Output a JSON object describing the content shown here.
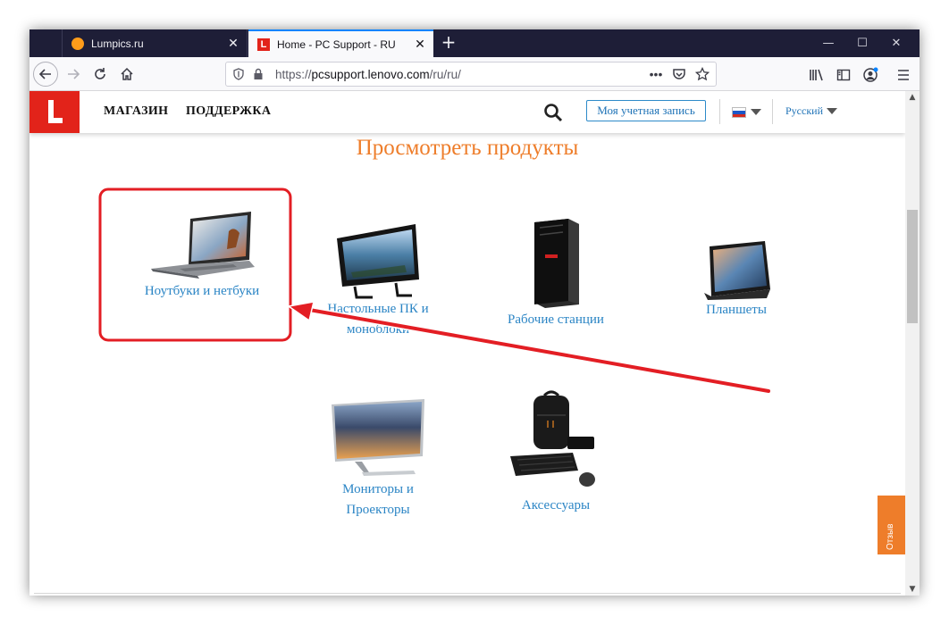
{
  "browser": {
    "tabs": [
      {
        "title": "Lumpics.ru",
        "favicon": "orange-circle-icon",
        "active": false
      },
      {
        "title": "Home - PC Support - RU",
        "favicon": "lenovo-l-icon",
        "active": true
      }
    ],
    "address": {
      "prefix": "https://",
      "host": "pcsupport.lenovo.com",
      "path": "/ru/ru/"
    },
    "accent_color": "#0a84ff"
  },
  "site_header": {
    "logo_letter": "L",
    "nav_shop": "МАГАЗИН",
    "nav_support": "ПОДДЕРЖКА",
    "account_button": "Моя учетная запись",
    "language": "Русский",
    "brand_color": "#e2231a"
  },
  "products": {
    "title": "Просмотреть продукты",
    "items": [
      {
        "label_line1": "Ноутбуки и нетбуки",
        "label_line2": "",
        "icon": "laptop-icon",
        "highlighted": true
      },
      {
        "label_line1": "Настольные ПК и",
        "label_line2": "моноблоки",
        "icon": "all-in-one-desktop-icon"
      },
      {
        "label_line1": "Рабочие станции",
        "label_line2": "",
        "icon": "workstation-tower-icon"
      },
      {
        "label_line1": "Планшеты",
        "label_line2": "",
        "icon": "tablet-icon"
      },
      {
        "label_line1": "Мониторы и",
        "label_line2": "Проекторы",
        "icon": "monitor-icon"
      },
      {
        "label_line1": "Аксессуары",
        "label_line2": "",
        "icon": "accessories-icon"
      }
    ],
    "title_color": "#ee7d2a",
    "link_color": "#2b85c5"
  },
  "feedback": {
    "label": "Отзыв",
    "color": "#ee7d2a"
  },
  "annotation": {
    "color": "#e31e24"
  }
}
